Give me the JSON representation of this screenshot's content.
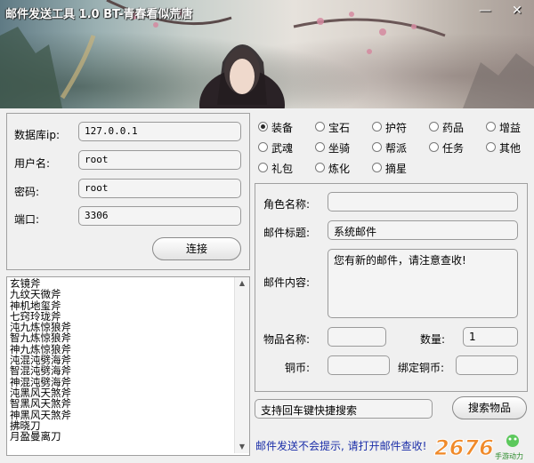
{
  "title": "邮件发送工具 1.0 BT-青春看似荒唐",
  "window_controls": {
    "minimize": "—",
    "close": "✕"
  },
  "db": {
    "ip_label": "数据库ip:",
    "ip_value": "127.0.0.1",
    "user_label": "用户名:",
    "user_value": "root",
    "pass_label": "密码:",
    "pass_value": "root",
    "port_label": "端口:",
    "port_value": "3306",
    "connect_label": "连接"
  },
  "categories": [
    {
      "label": "装备",
      "selected": true
    },
    {
      "label": "宝石",
      "selected": false
    },
    {
      "label": "护符",
      "selected": false
    },
    {
      "label": "药品",
      "selected": false
    },
    {
      "label": "增益",
      "selected": false
    },
    {
      "label": "武魂",
      "selected": false
    },
    {
      "label": "坐骑",
      "selected": false
    },
    {
      "label": "帮派",
      "selected": false
    },
    {
      "label": "任务",
      "selected": false
    },
    {
      "label": "其他",
      "selected": false
    },
    {
      "label": "礼包",
      "selected": false
    },
    {
      "label": "炼化",
      "selected": false
    },
    {
      "label": "摘星",
      "selected": false
    }
  ],
  "mail": {
    "role_label": "角色名称:",
    "role_value": "",
    "subject_label": "邮件标题:",
    "subject_value": "系统邮件",
    "content_label": "邮件内容:",
    "content_value": "您有新的邮件，请注意查收!",
    "item_label": "物品名称:",
    "item_value": "",
    "qty_label": "数量:",
    "qty_value": "1",
    "copper_label": "铜币:",
    "copper_value": "",
    "bound_copper_label": "绑定铜币:",
    "bound_copper_value": ""
  },
  "search": {
    "value": "支持回车键快捷搜索",
    "button_label": "搜索物品"
  },
  "items": [
    "玄镜斧",
    "九纹天微斧",
    "神机地玺斧",
    "七窍玲珑斧",
    "沌九炼惊狼斧",
    "智九炼惊狼斧",
    "神九炼惊狼斧",
    "沌混沌劈海斧",
    "智混沌劈海斧",
    "神混沌劈海斧",
    "沌黑风天煞斧",
    "智黑风天煞斧",
    "神黑风天煞斧",
    "拂晓刀",
    "月盈曼离刀"
  ],
  "status_text": "邮件发送不会提示, 请打开邮件查收!",
  "logo": {
    "text": "2676",
    "tagline": "手游动力"
  },
  "colors": {
    "status": "#1b2ea8",
    "window_bg": "#f0f0f0"
  }
}
